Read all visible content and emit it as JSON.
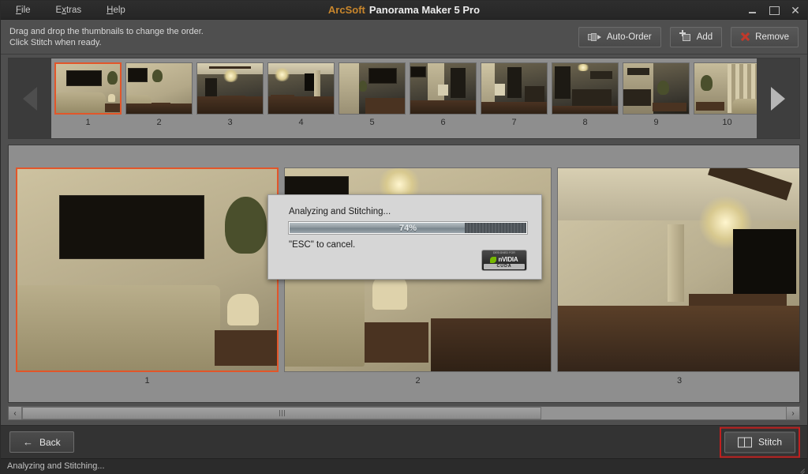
{
  "window": {
    "brand": "ArcSoft",
    "product": "Panorama Maker 5 Pro",
    "minimize_label": "–",
    "maximize_label": "□",
    "close_label": "✕"
  },
  "menu": {
    "items": [
      {
        "label": "File",
        "mnemonic": "F"
      },
      {
        "label": "Extras",
        "mnemonic": "x"
      },
      {
        "label": "Help",
        "mnemonic": "H"
      }
    ]
  },
  "toolbar": {
    "hint_line1": "Drag and drop the thumbnails to change the order.",
    "hint_line2": "Click Stitch when ready.",
    "auto_order_label": "Auto-Order",
    "add_label": "Add",
    "remove_label": "Remove"
  },
  "strip": {
    "left_arrow_name": "arrow-left-icon",
    "right_arrow_name": "arrow-right-icon",
    "thumbnails": [
      {
        "label": "1",
        "scene": "livingroom-art-sofa",
        "selected": true
      },
      {
        "label": "2",
        "scene": "livingroom-art-right",
        "selected": false
      },
      {
        "label": "3",
        "scene": "dining-chandelier",
        "selected": false
      },
      {
        "label": "4",
        "scene": "dining-chandelier-right",
        "selected": false
      },
      {
        "label": "5",
        "scene": "hall-artwork",
        "selected": false
      },
      {
        "label": "6",
        "scene": "hall-doorway",
        "selected": false
      },
      {
        "label": "7",
        "scene": "hall-doorway-right",
        "selected": false
      },
      {
        "label": "8",
        "scene": "stair-rail-dark",
        "selected": false
      },
      {
        "label": "9",
        "scene": "stair-rail-table",
        "selected": false
      },
      {
        "label": "10",
        "scene": "entry-curtains",
        "selected": false
      }
    ]
  },
  "preview": {
    "panels": [
      {
        "label": "1",
        "scene": "livingroom-art-sofa",
        "selected": true
      },
      {
        "label": "2",
        "scene": "livingroom-lamp-table",
        "selected": false
      },
      {
        "label": "3",
        "scene": "dining-room-wide",
        "selected": false
      }
    ],
    "scroll_left_label": "‹",
    "scroll_right_label": "›"
  },
  "dialog": {
    "title": "Analyzing and Stitching...",
    "progress_percent": 74,
    "progress_label": "74%",
    "cancel_hint": "\"ESC\" to cancel.",
    "badge": {
      "top_text": "DESIGNED FOR",
      "name": "nVIDIA",
      "bottom_text": "CUDA"
    }
  },
  "footer": {
    "back_label": "Back",
    "back_icon": "←",
    "stitch_label": "Stitch",
    "stitch_highlight_color": "#c0201f"
  },
  "statusbar": {
    "text": "Analyzing and Stitching..."
  },
  "colors": {
    "accent_orange": "#c8862c",
    "selection_orange": "#e2562a",
    "highlight_red": "#c0201f",
    "window_chrome": "#4f4f4f",
    "panel_gray": "#8e8e8e",
    "dialog_bg": "#d6d6d6",
    "nvidia_green": "#76b900"
  }
}
